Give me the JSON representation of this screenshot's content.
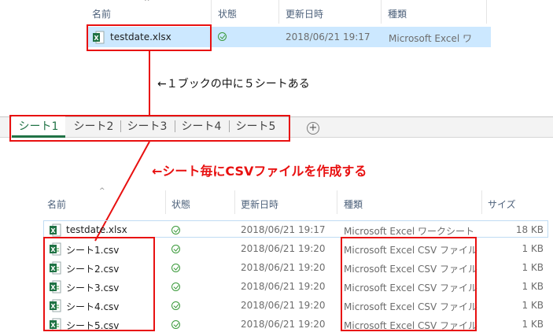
{
  "top_explorer": {
    "columns": [
      "名前",
      "状態",
      "更新日時",
      "種類"
    ],
    "row": {
      "name": "testdate.xlsx",
      "date": "2018/06/21 19:17",
      "type": "Microsoft Excel ワ"
    }
  },
  "annotation_1": "←１ブックの中に５シートある",
  "sheet_tabs": [
    "シート1",
    "シート2",
    "シート3",
    "シート4",
    "シート5"
  ],
  "annotation_2": "←シート毎にCSVファイルを作成する",
  "bottom_explorer": {
    "columns": [
      "名前",
      "状態",
      "更新日時",
      "種類",
      "サイズ"
    ],
    "rows": [
      {
        "name": "testdate.xlsx",
        "date": "2018/06/21 19:17",
        "type": "Microsoft Excel ワークシート",
        "size": "18 KB"
      },
      {
        "name": "シート1.csv",
        "date": "2018/06/21 19:20",
        "type": "Microsoft Excel CSV ファイル",
        "size": "1 KB"
      },
      {
        "name": "シート2.csv",
        "date": "2018/06/21 19:20",
        "type": "Microsoft Excel CSV ファイル",
        "size": "1 KB"
      },
      {
        "name": "シート3.csv",
        "date": "2018/06/21 19:20",
        "type": "Microsoft Excel CSV ファイル",
        "size": "1 KB"
      },
      {
        "name": "シート4.csv",
        "date": "2018/06/21 19:20",
        "type": "Microsoft Excel CSV ファイル",
        "size": "1 KB"
      },
      {
        "name": "シート5.csv",
        "date": "2018/06/21 19:20",
        "type": "Microsoft Excel CSV ファイル",
        "size": "1 KB"
      }
    ]
  },
  "colors": {
    "annotation_red": "#e81010",
    "selection": "#cce8ff",
    "active_tab_text": "#217346"
  }
}
